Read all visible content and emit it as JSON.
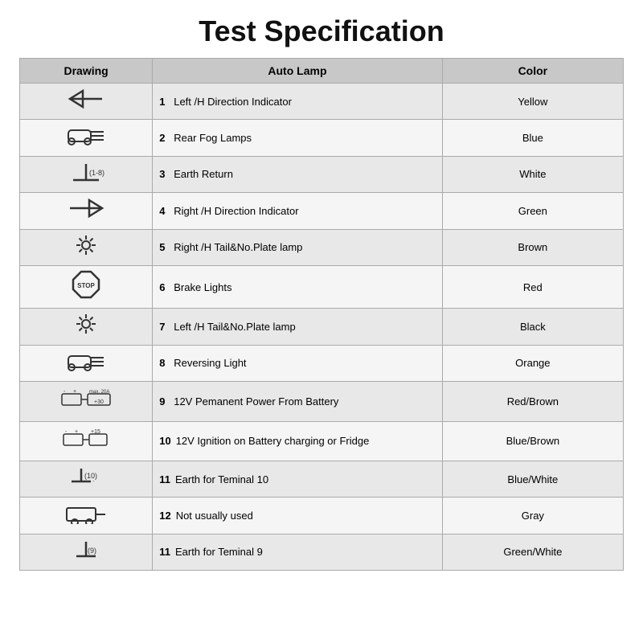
{
  "title": "Test Specification",
  "headers": {
    "drawing": "Drawing",
    "lamp": "Auto Lamp",
    "color": "Color"
  },
  "rows": [
    {
      "num": "1",
      "lamp": "Left /H Direction Indicator",
      "color": "Yellow",
      "icon": "left-arrow"
    },
    {
      "num": "2",
      "lamp": "Rear Fog Lamps",
      "color": "Blue",
      "icon": "car-fog"
    },
    {
      "num": "3",
      "lamp": "Earth Return",
      "color": "White",
      "icon": "earth-18"
    },
    {
      "num": "4",
      "lamp": "Right /H Direction Indicator",
      "color": "Green",
      "icon": "right-arrow"
    },
    {
      "num": "5",
      "lamp": "Right /H Tail&No.Plate lamp",
      "color": "Brown",
      "icon": "sun-right"
    },
    {
      "num": "6",
      "lamp": "Brake Lights",
      "color": "Red",
      "icon": "stop"
    },
    {
      "num": "7",
      "lamp": "Left /H Tail&No.Plate lamp",
      "color": "Black",
      "icon": "sun-left"
    },
    {
      "num": "8",
      "lamp": "Reversing Light",
      "color": "Orange",
      "icon": "car-reverse"
    },
    {
      "num": "9",
      "lamp": "12V Pemanent Power From Battery",
      "color": "Red/Brown",
      "icon": "battery-20a"
    },
    {
      "num": "10",
      "lamp": "12V Ignition on Battery  charging or Fridge",
      "color": "Blue/Brown",
      "icon": "battery-15"
    },
    {
      "num": "11",
      "lamp": "Earth for Teminal  10",
      "color": "Blue/White",
      "icon": "earth-10"
    },
    {
      "num": "12",
      "lamp": "Not usually used",
      "color": "Gray",
      "icon": "trailer"
    },
    {
      "num": "11",
      "lamp": "Earth for Teminal  9",
      "color": "Green/White",
      "icon": "earth-9"
    }
  ]
}
